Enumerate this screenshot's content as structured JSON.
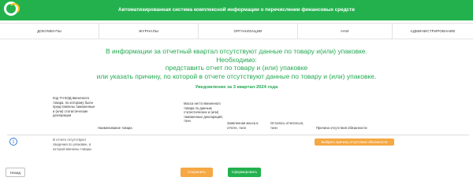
{
  "header": {
    "title": "Автоматизированная система комплексной информации о перечислении финансовых средств"
  },
  "nav": {
    "items": [
      {
        "label": "ДОКУМЕНТЫ"
      },
      {
        "label": "ЖУРНАЛЫ"
      },
      {
        "label": "ОРГАНИЗАЦИИ"
      },
      {
        "label": "НАИ"
      },
      {
        "label": "АДМИНИСТРИРОВАНИЕ"
      }
    ]
  },
  "message": {
    "line1": "В информации за отчетный квартал отсутствуют данные по товару и(или) упаковке.",
    "line2": "Необходимо:",
    "line3": "представить отчет по товару и (или) упаковке",
    "line4": "или указать причину, по которой в отчете отсутствуют данные по товару и (или) упаковке."
  },
  "notice": {
    "title": "Уведомление за 3 квартал 2024 года"
  },
  "table": {
    "headers": [
      "Код ТН ВЭД ввезенного товара, по которому были представлены таможенные и (или) статистические декларации",
      "Наименование товара",
      "Масса нетто ввезенного товара по данным статистических и (или) таможенных деклараций, тонн",
      "Заявленная масса в отчете, тонн",
      "Осталось отчитаться, тонн",
      "Причина отсутствия обязанности"
    ],
    "row": {
      "text": "В отчете отсутствуют сведения по упаковке, в которой ввезены товары",
      "reason_button": "Выбрать причину отсутствия обязанности"
    }
  },
  "footer": {
    "back_label": "Назад",
    "save_label": "Сохранить",
    "form_label": "Сформировать"
  },
  "colors": {
    "brand_green": "#23b14d",
    "text_green": "#23a952",
    "accent_orange": "#f5a843",
    "info_blue": "#3a7bd5"
  }
}
